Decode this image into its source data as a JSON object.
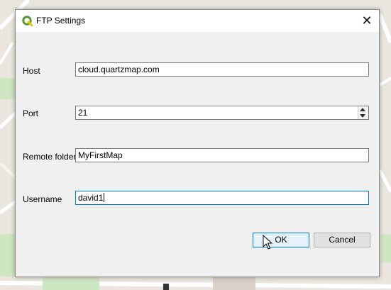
{
  "dialog": {
    "title": "FTP Settings",
    "close_glyph": "✕",
    "fields": {
      "host": {
        "label": "Host",
        "value": "cloud.quartzmap.com"
      },
      "port": {
        "label": "Port",
        "value": "21"
      },
      "remote_folder": {
        "label": "Remote folder",
        "value": "MyFirstMap"
      },
      "username": {
        "label": "Username",
        "value": "david1"
      }
    },
    "buttons": {
      "ok": "OK",
      "cancel": "Cancel"
    }
  },
  "icons": {
    "app": "qgis-icon",
    "close": "close-icon",
    "spin_up": "chevron-up-icon",
    "spin_down": "chevron-down-icon",
    "cursor": "mouse-pointer-icon"
  },
  "colors": {
    "map_background": "#eae6df",
    "qgis_green": "#589632",
    "qgis_yellow": "#eec900",
    "focus_blue": "#0078d7"
  }
}
